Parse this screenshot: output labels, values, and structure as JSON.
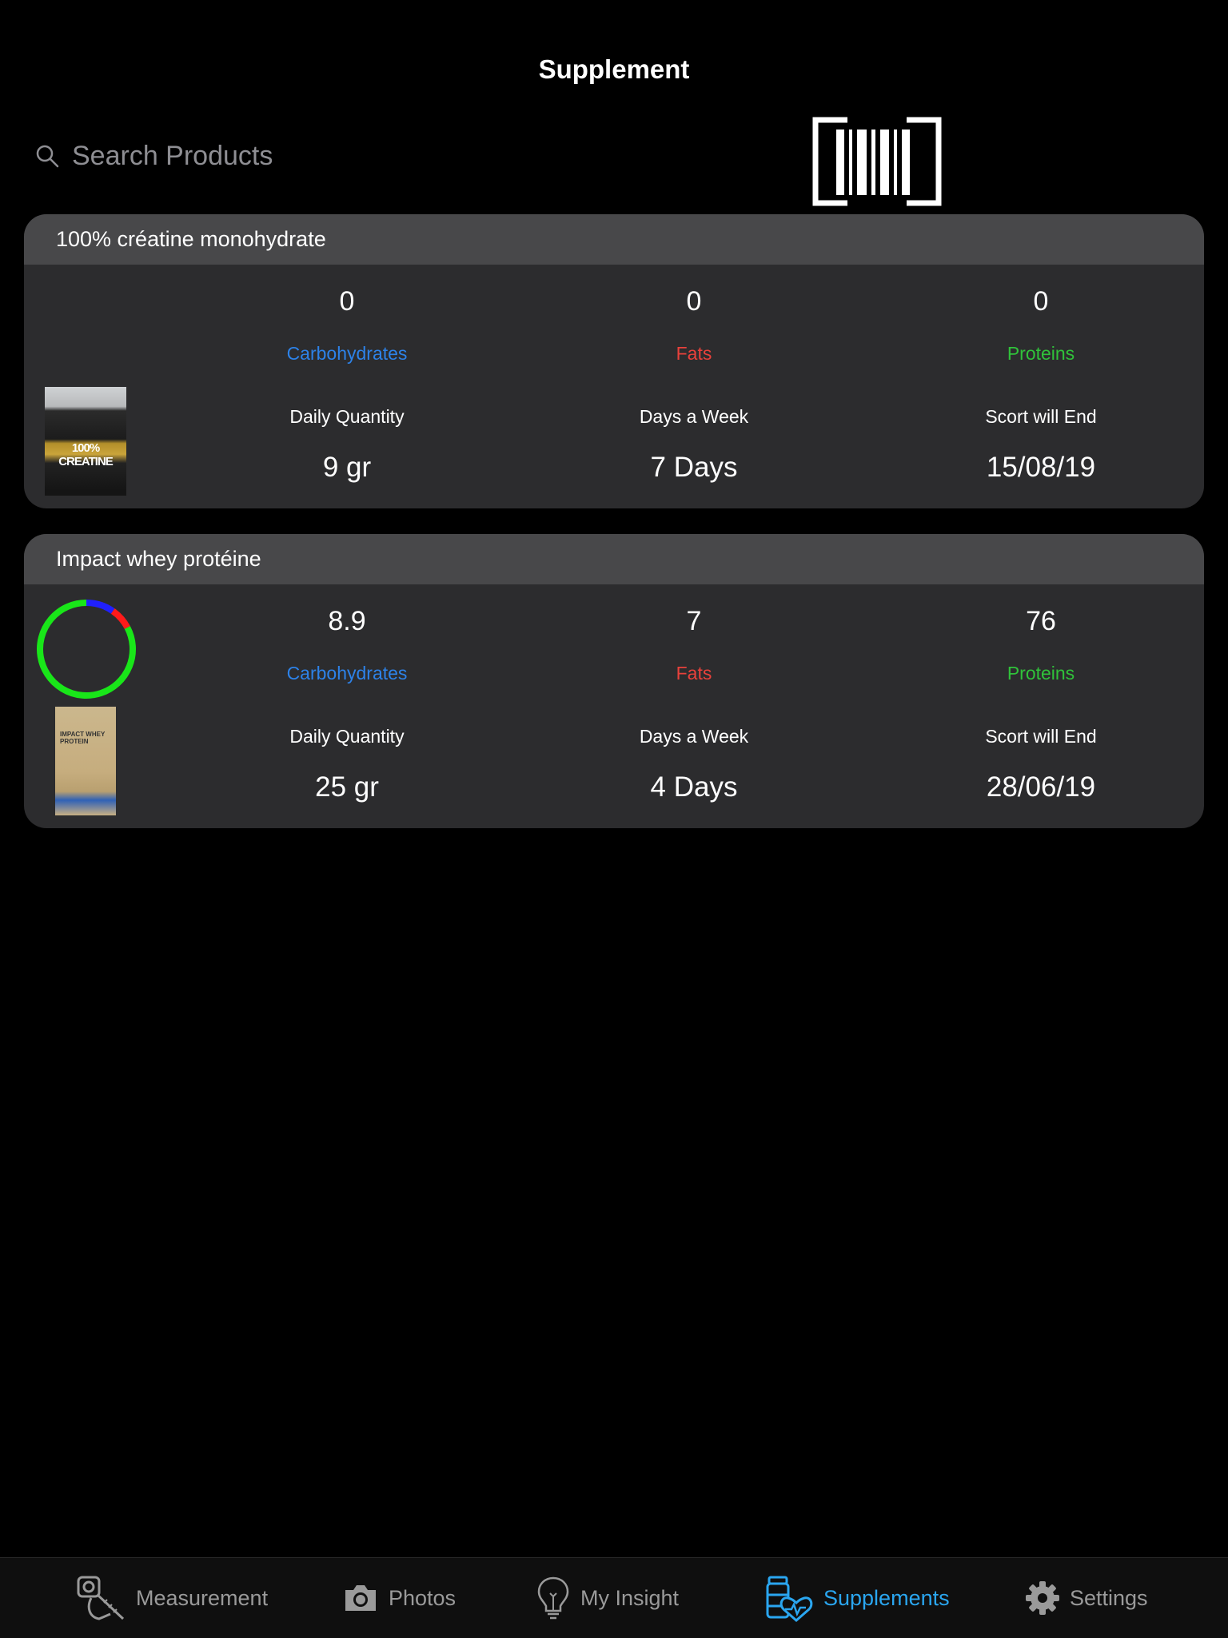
{
  "header": {
    "title": "Supplement"
  },
  "search": {
    "placeholder": "Search Products"
  },
  "icons": {
    "search": "search-icon",
    "scan": "barcode-icon",
    "measurement": "tape-measure-icon",
    "photos": "camera-icon",
    "insight": "lightbulb-icon",
    "supplements": "supplement-bottles-heart-icon",
    "settings": "gear-icon"
  },
  "colors": {
    "carbohydrates": "#2d82e8",
    "fats": "#e8413b",
    "proteins": "#30c23a",
    "active_tab": "#2aa6f0",
    "inactive_tab": "#9a9a9a"
  },
  "products": [
    {
      "name": "100% créatine monohydrate",
      "image_text": "100% CREATINE",
      "carbohydrates": "0",
      "fats": "0",
      "proteins": "0",
      "carbohydrates_label": "Carbohydrates",
      "fats_label": "Fats",
      "proteins_label": "Proteins",
      "daily_quantity_label": "Daily Quantity",
      "daily_quantity": "9 gr",
      "days_label": "Days a Week",
      "days": "7 Days",
      "end_label": "Scort will End",
      "end_date": "15/08/19"
    },
    {
      "name": "Impact whey protéine",
      "image_text": "IMPACT WHEY PROTEIN",
      "carbohydrates": "8.9",
      "fats": "7",
      "proteins": "76",
      "carbohydrates_label": "Carbohydrates",
      "fats_label": "Fats",
      "proteins_label": "Proteins",
      "daily_quantity_label": "Daily Quantity",
      "daily_quantity": "25 gr",
      "days_label": "Days a Week",
      "days": "4 Days",
      "end_label": "Scort will End",
      "end_date": "28/06/19",
      "macro_ring": {
        "carbohydrates": 8.9,
        "fats": 7,
        "proteins": 76
      }
    }
  ],
  "tabbar": [
    {
      "label": "Measurement",
      "active": false
    },
    {
      "label": "Photos",
      "active": false
    },
    {
      "label": "My Insight",
      "active": false
    },
    {
      "label": "Supplements",
      "active": true
    },
    {
      "label": "Settings",
      "active": false
    }
  ]
}
